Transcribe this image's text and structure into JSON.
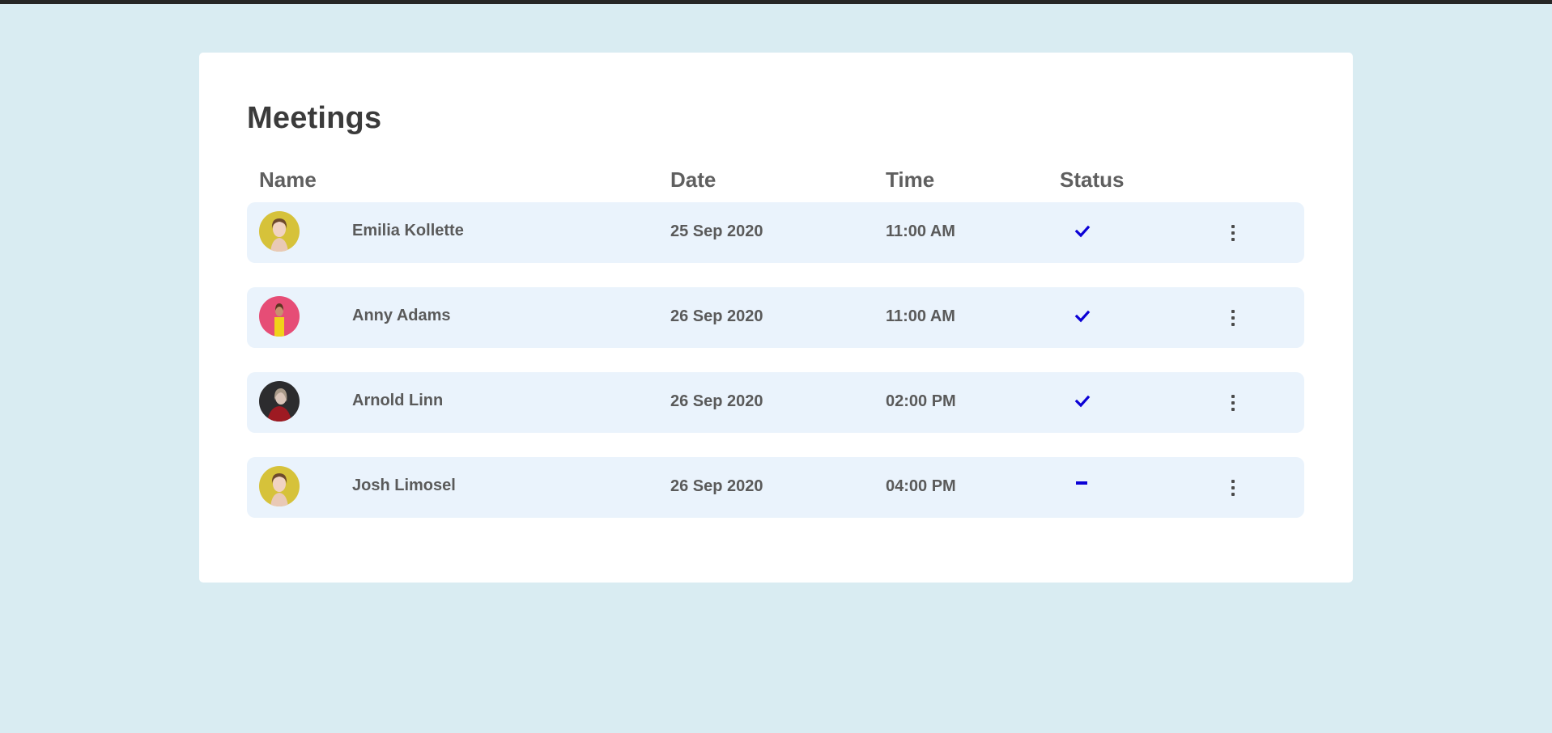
{
  "page": {
    "title": "Meetings"
  },
  "table": {
    "headers": {
      "name": "Name",
      "date": "Date",
      "time": "Time",
      "status": "Status"
    },
    "rows": [
      {
        "name": "Emilia Kollette",
        "date": "25 Sep 2020",
        "time": "11:00 AM",
        "status": "check-icon",
        "avatar": "avatar-yellow"
      },
      {
        "name": "Anny Adams",
        "date": "26 Sep 2020",
        "time": "11:00 AM",
        "status": "check-icon",
        "avatar": "avatar-pink"
      },
      {
        "name": "Arnold Linn",
        "date": "26 Sep 2020",
        "time": "02:00 PM",
        "status": "check-icon",
        "avatar": "avatar-dark"
      },
      {
        "name": "Josh Limosel",
        "date": "26 Sep 2020",
        "time": "04:00 PM",
        "status": "minus-icon",
        "avatar": "avatar-yellow"
      }
    ]
  },
  "colors": {
    "background": "#d9ecf2",
    "card": "#ffffff",
    "row": "#eaf3fc",
    "status_icon": "#0b00d6",
    "text": "#5a5a5a"
  }
}
